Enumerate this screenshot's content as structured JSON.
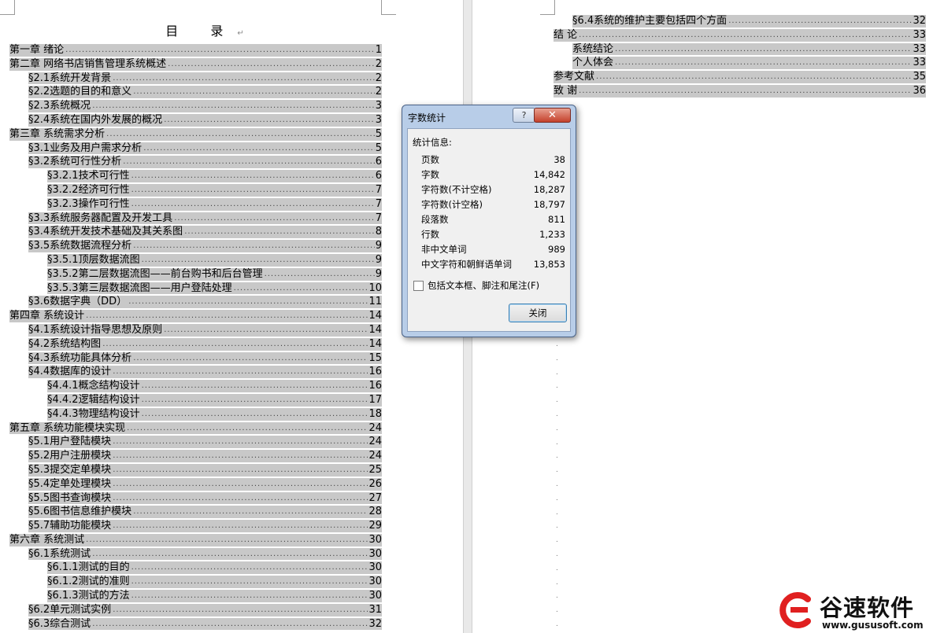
{
  "toc": {
    "title": "目 录",
    "title_mark": "↵",
    "left_entries": [
      {
        "level": 0,
        "text": "第一章 绪论",
        "page": "1"
      },
      {
        "level": 0,
        "text": "第二章 网络书店销售管理系统概述",
        "page": "2"
      },
      {
        "level": 1,
        "text": "§2.1系统开发背景",
        "page": "2"
      },
      {
        "level": 1,
        "text": "§2.2选题的目的和意义",
        "page": "2"
      },
      {
        "level": 1,
        "text": "§2.3系统概况",
        "page": "3"
      },
      {
        "level": 1,
        "text": "§2.4系统在国内外发展的概况",
        "page": "3"
      },
      {
        "level": 0,
        "text": "第三章 系统需求分析",
        "page": "5"
      },
      {
        "level": 1,
        "text": "§3.1业务及用户需求分析",
        "page": "5"
      },
      {
        "level": 1,
        "text": "§3.2系统可行性分析",
        "page": "6"
      },
      {
        "level": 2,
        "text": "§3.2.1技术可行性",
        "page": "6"
      },
      {
        "level": 2,
        "text": "§3.2.2经济可行性",
        "page": "7"
      },
      {
        "level": 2,
        "text": "§3.2.3操作可行性",
        "page": "7"
      },
      {
        "level": 1,
        "text": "§3.3系统服务器配置及开发工具",
        "page": "7"
      },
      {
        "level": 1,
        "text": "§3.4系统开发技术基础及其关系图",
        "page": "8"
      },
      {
        "level": 1,
        "text": "§3.5系统数据流程分析",
        "page": "9"
      },
      {
        "level": 2,
        "text": "§3.5.1顶层数据流图",
        "page": "9"
      },
      {
        "level": 2,
        "text": "§3.5.2第二层数据流图——前台购书和后台管理",
        "page": "9"
      },
      {
        "level": 2,
        "text": "§3.5.3第三层数据流图——用户登陆处理",
        "page": "10"
      },
      {
        "level": 1,
        "text": "§3.6数据字典（DD）",
        "page": "11"
      },
      {
        "level": 0,
        "text": "第四章 系统设计",
        "page": "14"
      },
      {
        "level": 1,
        "text": "§4.1系统设计指导思想及原则",
        "page": "14"
      },
      {
        "level": 1,
        "text": "§4.2系统结构图",
        "page": "14"
      },
      {
        "level": 1,
        "text": "§4.3系统功能具体分析",
        "page": "15"
      },
      {
        "level": 1,
        "text": "§4.4数据库的设计",
        "page": "16"
      },
      {
        "level": 2,
        "text": "§4.4.1概念结构设计",
        "page": "16"
      },
      {
        "level": 2,
        "text": "§4.4.2逻辑结构设计",
        "page": "17"
      },
      {
        "level": 2,
        "text": "§4.4.3物理结构设计",
        "page": "18"
      },
      {
        "level": 0,
        "text": "第五章 系统功能模块实现",
        "page": "24"
      },
      {
        "level": 1,
        "text": "§5.1用户登陆模块",
        "page": "24"
      },
      {
        "level": 1,
        "text": "§5.2用户注册模块",
        "page": "24"
      },
      {
        "level": 1,
        "text": "§5.3提交定单模块",
        "page": "25"
      },
      {
        "level": 1,
        "text": "§5.4定单处理模块",
        "page": "26"
      },
      {
        "level": 1,
        "text": "§5.5图书查询模块",
        "page": "27"
      },
      {
        "level": 1,
        "text": "§5.6图书信息维护模块",
        "page": "28"
      },
      {
        "level": 1,
        "text": "§5.7辅助功能模块",
        "page": "29"
      },
      {
        "level": 0,
        "text": "第六章 系统测试",
        "page": "30"
      },
      {
        "level": 1,
        "text": "§6.1系统测试",
        "page": "30"
      },
      {
        "level": 2,
        "text": "§6.1.1测试的目的",
        "page": "30"
      },
      {
        "level": 2,
        "text": "§6.1.2测试的准则",
        "page": "30"
      },
      {
        "level": 2,
        "text": "§6.1.3测试的方法",
        "page": "30"
      },
      {
        "level": 1,
        "text": "§6.2单元测试实例",
        "page": "31"
      },
      {
        "level": 1,
        "text": "§6.3综合测试",
        "page": "32"
      }
    ],
    "right_entries": [
      {
        "level": 1,
        "text": "§6.4系统的维护主要包括四个方面",
        "page": "32"
      },
      {
        "level": 0,
        "text": "结 论",
        "page": "33"
      },
      {
        "level": 1,
        "text": "系统结论",
        "page": "33"
      },
      {
        "level": 1,
        "text": "个人体会",
        "page": "33"
      },
      {
        "level": 0,
        "text": "参考文献",
        "page": "35"
      },
      {
        "level": 0,
        "text": "致 谢",
        "page": "36"
      }
    ]
  },
  "dialog": {
    "title": "字数统计",
    "help_label": "?",
    "close_label": "✕",
    "section_label": "统计信息:",
    "stats": [
      {
        "label": "页数",
        "value": "38"
      },
      {
        "label": "字数",
        "value": "14,842"
      },
      {
        "label": "字符数(不计空格)",
        "value": "18,287"
      },
      {
        "label": "字符数(计空格)",
        "value": "18,797"
      },
      {
        "label": "段落数",
        "value": "811"
      },
      {
        "label": "行数",
        "value": "1,233"
      },
      {
        "label": "非中文单词",
        "value": "989"
      },
      {
        "label": "中文字符和朝鲜语单词",
        "value": "13,853"
      }
    ],
    "checkbox_label": "包括文本框、脚注和尾注(F)",
    "checkbox_checked": false,
    "button_label": "关闭"
  },
  "logo": {
    "text": "谷速软件",
    "url": "www.gususoft.com",
    "brand_color": "#e02020"
  }
}
